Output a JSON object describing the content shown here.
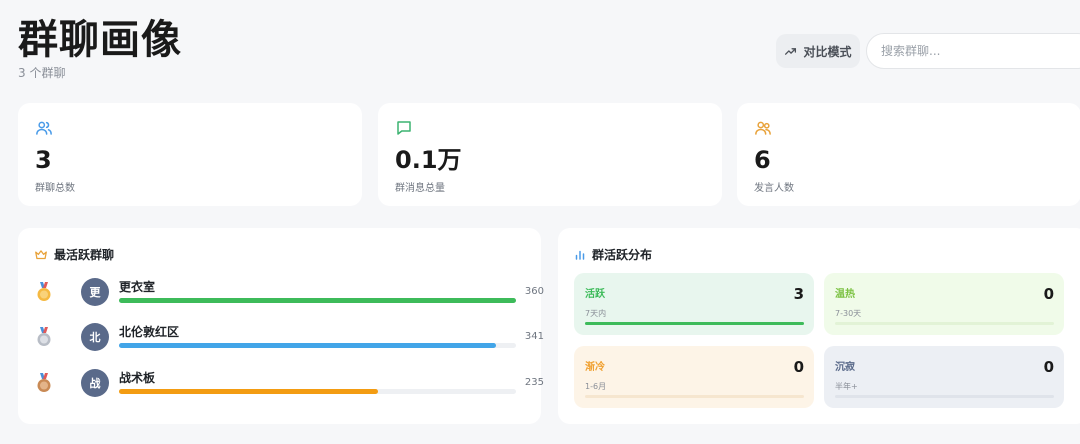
{
  "header": {
    "title": "群聊画像",
    "subtitle": "3 个群聊",
    "compare_button": "对比模式",
    "search_placeholder": "搜索群聊..."
  },
  "stats": [
    {
      "value": "3",
      "label": "群聊总数",
      "icon": "users-icon",
      "color": "#4a9be8"
    },
    {
      "value": "0.1万",
      "label": "群消息总量",
      "icon": "message-icon",
      "color": "#3cb371"
    },
    {
      "value": "6",
      "label": "发言人数",
      "icon": "speakers-icon",
      "color": "#e8a23a"
    }
  ],
  "ranking": {
    "title": "最活跃群聊",
    "icon": "crown-icon",
    "items": [
      {
        "rank": 1,
        "avatar": "更",
        "name": "更衣室",
        "count": "360",
        "fraction": 1.0,
        "color": "#3dbb5a"
      },
      {
        "rank": 2,
        "avatar": "北",
        "name": "北伦敦红区",
        "count": "341",
        "fraction": 0.95,
        "color": "#42a5e8"
      },
      {
        "rank": 3,
        "avatar": "战",
        "name": "战术板",
        "count": "235",
        "fraction": 0.653,
        "color": "#f39c12"
      }
    ]
  },
  "distribution": {
    "title": "群活跃分布",
    "icon": "bar-chart-icon",
    "cards": [
      {
        "label": "活跃",
        "range": "7天内",
        "count": "3",
        "fill": 1.0,
        "label_color": "#3dbb5a",
        "bar_color": "#3dbb5a",
        "bg": "#e8f6ee",
        "track": "#d5eddf"
      },
      {
        "label": "温热",
        "range": "7-30天",
        "count": "0",
        "fill": 0,
        "label_color": "#7cc243",
        "bar_color": "#7cc243",
        "bg": "#f0fbe9",
        "track": "#e2f3d6"
      },
      {
        "label": "渐冷",
        "range": "1-6月",
        "count": "0",
        "fill": 0,
        "label_color": "#f0a030",
        "bar_color": "#f0a030",
        "bg": "#fdf4e7",
        "track": "#f6e6cf"
      },
      {
        "label": "沉寂",
        "range": "半年+",
        "count": "0",
        "fill": 0,
        "label_color": "#5a6a8a",
        "bar_color": "#5a6a8a",
        "bg": "#eceff4",
        "track": "#dfe3ea"
      }
    ]
  }
}
